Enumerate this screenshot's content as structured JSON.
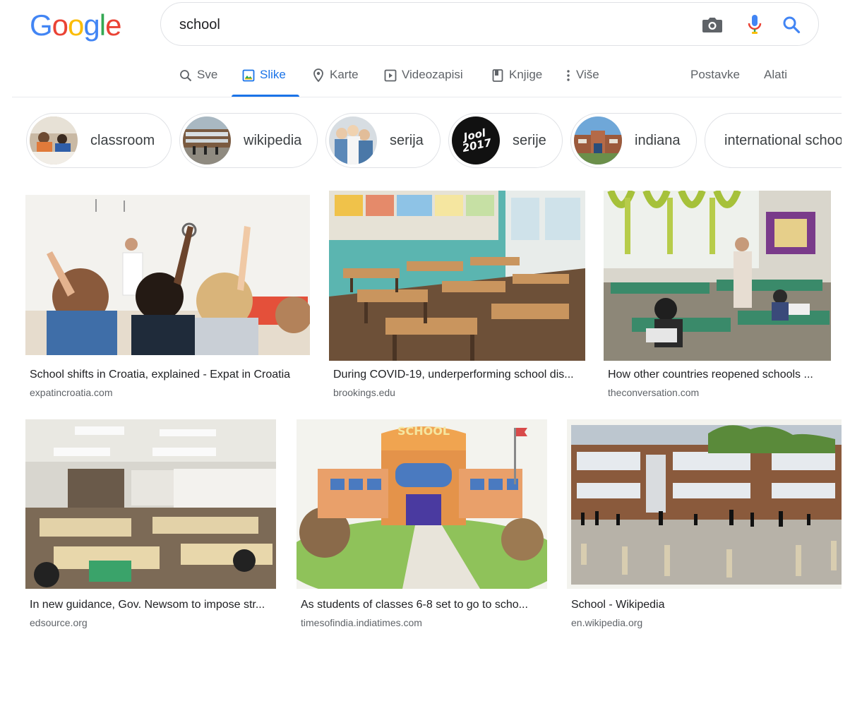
{
  "logo": {
    "letters": [
      "G",
      "o",
      "o",
      "g",
      "l",
      "e"
    ],
    "colors": [
      "#4285F4",
      "#EA4335",
      "#FBBC05",
      "#4285F4",
      "#34A853",
      "#EA4335"
    ]
  },
  "search": {
    "query": "school",
    "icons": [
      "camera-icon",
      "mic-icon",
      "search-icon"
    ]
  },
  "tabs": [
    {
      "label": "Sve",
      "icon": "search-icon"
    },
    {
      "label": "Slike",
      "icon": "image-icon",
      "active": true
    },
    {
      "label": "Karte",
      "icon": "map-pin-icon"
    },
    {
      "label": "Videozapisi",
      "icon": "play-icon"
    },
    {
      "label": "Knjige",
      "icon": "book-icon"
    },
    {
      "label": "Više",
      "icon": "more-vert-icon"
    }
  ],
  "tools": {
    "settings": "Postavke",
    "tools": "Alati"
  },
  "chips": [
    {
      "label": "classroom"
    },
    {
      "label": "wikipedia"
    },
    {
      "label": "serija"
    },
    {
      "label": "serije",
      "thumb_text": "Jool 2017"
    },
    {
      "label": "indiana"
    },
    {
      "label": "international school"
    }
  ],
  "results": [
    {
      "caption": "School shifts in Croatia, explained - Expat in Croatia",
      "source": "expatincroatia.com"
    },
    {
      "caption": "During COVID-19, underperforming school dis...",
      "source": "brookings.edu"
    },
    {
      "caption": "How other countries reopened schools ...",
      "source": "theconversation.com"
    },
    {
      "caption": "In new guidance, Gov. Newsom to impose str...",
      "source": "edsource.org"
    },
    {
      "caption": "As students of classes 6-8 set to go to scho...",
      "source": "timesofindia.indiatimes.com",
      "sign_text": "SCHOOL"
    },
    {
      "caption": "School - Wikipedia",
      "source": "en.wikipedia.org"
    }
  ]
}
